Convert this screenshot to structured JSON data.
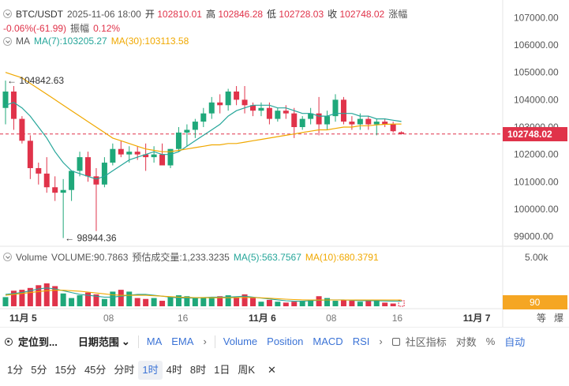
{
  "header": {
    "symbol": "BTC/USDT",
    "datetime": "2025-11-06 18:00",
    "open_label": "开",
    "open_value": "102810.01",
    "high_label": "高",
    "high_value": "102846.28",
    "low_label": "低",
    "low_value": "102728.03",
    "close_label": "收",
    "close_value": "102748.02",
    "change_label": "涨幅",
    "change_value": "-0.06%(-61.99)",
    "amplitude_label": "振幅",
    "amplitude_value": "0.12%"
  },
  "ma_legend": {
    "label": "MA",
    "ma7": "MA(7):103205.27",
    "ma30": "MA(30):103113.58"
  },
  "volume_legend": {
    "label": "Volume",
    "volume": "VOLUME:90.7863",
    "estimated": "预估成交量:1,233.3235",
    "ma5": "MA(5):563.7567",
    "ma10": "MA(10):680.3791"
  },
  "annotations": {
    "high_marker": "← 104842.63",
    "low_marker": "← 98944.36"
  },
  "price_axis": [
    "107000.00",
    "106000.00",
    "105000.00",
    "104000.00",
    "103000.00",
    "102000.00",
    "101000.00",
    "100000.00",
    "99000.00"
  ],
  "volume_axis": [
    "5.00k"
  ],
  "current_price": "102748.02",
  "current_volume": "90",
  "time_axis": [
    "11月 5",
    "08",
    "16",
    "11月 6",
    "08",
    "16",
    "11月 7"
  ],
  "axis_buttons": [
    "等",
    "爆"
  ],
  "toolbar": {
    "locate": "定位到...",
    "date_range": "日期范围",
    "ma": "MA",
    "ema": "EMA",
    "volume": "Volume",
    "position": "Position",
    "macd": "MACD",
    "rsi": "RSI",
    "community": "社区指标",
    "log": "对数",
    "percent": "%",
    "auto": "自动"
  },
  "intervals": [
    "1分",
    "5分",
    "15分",
    "45分",
    "分时",
    "1时",
    "4时",
    "8时",
    "1日",
    "周K"
  ],
  "active_interval": "1时",
  "colors": {
    "up": "#1fa87a",
    "down": "#e0334a",
    "ma7": "#26a69a",
    "ma30": "#f0a800",
    "accent": "#3b73d6"
  },
  "chart_data": {
    "type": "candlestick",
    "ylim": [
      98700,
      107300
    ],
    "candles": [
      {
        "o": 103700,
        "h": 104700,
        "l": 103100,
        "c": 104300
      },
      {
        "o": 104300,
        "h": 104500,
        "l": 102900,
        "c": 103300
      },
      {
        "o": 103300,
        "h": 103400,
        "l": 102400,
        "c": 102500
      },
      {
        "o": 102500,
        "h": 102700,
        "l": 101100,
        "c": 101500
      },
      {
        "o": 101500,
        "h": 101700,
        "l": 100900,
        "c": 101300
      },
      {
        "o": 101300,
        "h": 101900,
        "l": 100600,
        "c": 100800
      },
      {
        "o": 100800,
        "h": 101200,
        "l": 100300,
        "c": 100600
      },
      {
        "o": 100600,
        "h": 101100,
        "l": 98944,
        "c": 100700
      },
      {
        "o": 100700,
        "h": 101400,
        "l": 100300,
        "c": 101400
      },
      {
        "o": 101400,
        "h": 102100,
        "l": 101200,
        "c": 101900
      },
      {
        "o": 101900,
        "h": 102100,
        "l": 101000,
        "c": 101200
      },
      {
        "o": 101200,
        "h": 101500,
        "l": 99200,
        "c": 100900
      },
      {
        "o": 100900,
        "h": 101900,
        "l": 100800,
        "c": 101700
      },
      {
        "o": 101700,
        "h": 102400,
        "l": 101600,
        "c": 102200
      },
      {
        "o": 102200,
        "h": 102500,
        "l": 101900,
        "c": 102000
      },
      {
        "o": 102000,
        "h": 102300,
        "l": 101700,
        "c": 102100
      },
      {
        "o": 102100,
        "h": 102300,
        "l": 101800,
        "c": 102000
      },
      {
        "o": 102000,
        "h": 102400,
        "l": 101400,
        "c": 101900
      },
      {
        "o": 101900,
        "h": 102300,
        "l": 101700,
        "c": 102000
      },
      {
        "o": 102000,
        "h": 102400,
        "l": 101600,
        "c": 101600
      },
      {
        "o": 101600,
        "h": 102200,
        "l": 101500,
        "c": 102200
      },
      {
        "o": 102200,
        "h": 103000,
        "l": 102100,
        "c": 102800
      },
      {
        "o": 102800,
        "h": 103100,
        "l": 102300,
        "c": 102900
      },
      {
        "o": 102900,
        "h": 103300,
        "l": 102600,
        "c": 103200
      },
      {
        "o": 103200,
        "h": 103700,
        "l": 103000,
        "c": 103500
      },
      {
        "o": 103500,
        "h": 104100,
        "l": 103300,
        "c": 103900
      },
      {
        "o": 103900,
        "h": 104200,
        "l": 103500,
        "c": 103800
      },
      {
        "o": 103800,
        "h": 104400,
        "l": 103600,
        "c": 104300
      },
      {
        "o": 104300,
        "h": 104500,
        "l": 103800,
        "c": 104000
      },
      {
        "o": 104000,
        "h": 104500,
        "l": 103500,
        "c": 103800
      },
      {
        "o": 103800,
        "h": 103900,
        "l": 103400,
        "c": 103600
      },
      {
        "o": 103600,
        "h": 103900,
        "l": 103400,
        "c": 103700
      },
      {
        "o": 103700,
        "h": 103900,
        "l": 103100,
        "c": 103300
      },
      {
        "o": 103300,
        "h": 103700,
        "l": 103200,
        "c": 103600
      },
      {
        "o": 103600,
        "h": 103800,
        "l": 103300,
        "c": 103500
      },
      {
        "o": 103500,
        "h": 103700,
        "l": 102600,
        "c": 103000
      },
      {
        "o": 103000,
        "h": 103400,
        "l": 102900,
        "c": 103300
      },
      {
        "o": 103300,
        "h": 103700,
        "l": 103100,
        "c": 103500
      },
      {
        "o": 103500,
        "h": 104100,
        "l": 102700,
        "c": 103100
      },
      {
        "o": 103100,
        "h": 103600,
        "l": 102900,
        "c": 103400
      },
      {
        "o": 103400,
        "h": 104200,
        "l": 103200,
        "c": 104000
      },
      {
        "o": 104000,
        "h": 104100,
        "l": 103100,
        "c": 103200
      },
      {
        "o": 103200,
        "h": 103400,
        "l": 102900,
        "c": 103100
      },
      {
        "o": 103100,
        "h": 103500,
        "l": 102900,
        "c": 103300
      },
      {
        "o": 103300,
        "h": 103400,
        "l": 102900,
        "c": 103100
      },
      {
        "o": 103100,
        "h": 103300,
        "l": 102700,
        "c": 103200
      },
      {
        "o": 103200,
        "h": 103300,
        "l": 103000,
        "c": 103100
      },
      {
        "o": 103100,
        "h": 103200,
        "l": 102800,
        "c": 102850
      },
      {
        "o": 102810,
        "h": 102846,
        "l": 102728,
        "c": 102748
      }
    ],
    "ma7": [
      103800,
      103900,
      103700,
      103400,
      103000,
      102600,
      102100,
      101700,
      101400,
      101300,
      101200,
      101100,
      101200,
      101400,
      101600,
      101800,
      101900,
      102000,
      102100,
      102000,
      102000,
      102100,
      102300,
      102500,
      102700,
      102900,
      103100,
      103400,
      103600,
      103700,
      103800,
      103800,
      103800,
      103700,
      103700,
      103600,
      103500,
      103500,
      103400,
      103400,
      103500,
      103500,
      103500,
      103400,
      103400,
      103300,
      103300,
      103250,
      103205
    ],
    "ma30": [
      105000,
      104900,
      104800,
      104600,
      104400,
      104200,
      104000,
      103800,
      103600,
      103400,
      103200,
      103000,
      102800,
      102600,
      102500,
      102400,
      102300,
      102200,
      102150,
      102100,
      102100,
      102150,
      102200,
      102250,
      102300,
      102350,
      102350,
      102400,
      102400,
      102450,
      102500,
      102550,
      102600,
      102650,
      102700,
      102750,
      102800,
      102850,
      102900,
      102900,
      102950,
      103000,
      103000,
      103050,
      103050,
      103080,
      103100,
      103110,
      103113
    ],
    "volume": [
      1000,
      1700,
      1800,
      2000,
      2300,
      2500,
      2200,
      1400,
      900,
      1200,
      1500,
      1300,
      800,
      1600,
      1800,
      1600,
      900,
      800,
      900,
      600,
      1000,
      1200,
      1100,
      900,
      1000,
      900,
      1100,
      1200,
      1000,
      1300,
      900,
      500,
      700,
      500,
      400,
      500,
      600,
      700,
      1100,
      900,
      600,
      700,
      600,
      500,
      600,
      700,
      400,
      300,
      91
    ],
    "vol_ma5": [
      1300,
      1400,
      1500,
      1700,
      1900,
      2000,
      1900,
      1700,
      1500,
      1300,
      1200,
      1100,
      1000,
      1000,
      1100,
      1200,
      1300,
      1300,
      1200,
      1100,
      1000,
      900,
      900,
      900,
      950,
      1000,
      1000,
      1000,
      1050,
      1100,
      1000,
      900,
      800,
      700,
      600,
      550,
      550,
      600,
      650,
      700,
      700,
      700,
      650,
      600,
      600,
      600,
      580,
      570,
      564
    ],
    "vol_ma10": [
      1200,
      1300,
      1400,
      1500,
      1600,
      1700,
      1750,
      1750,
      1700,
      1650,
      1550,
      1450,
      1350,
      1250,
      1200,
      1200,
      1200,
      1200,
      1150,
      1100,
      1050,
      1000,
      970,
      950,
      940,
      930,
      930,
      930,
      940,
      960,
      950,
      920,
      880,
      830,
      780,
      730,
      700,
      680,
      680,
      690,
      690,
      690,
      680,
      680,
      680,
      680,
      680,
      680,
      680
    ],
    "vol_ylim": [
      0,
      5000
    ]
  }
}
